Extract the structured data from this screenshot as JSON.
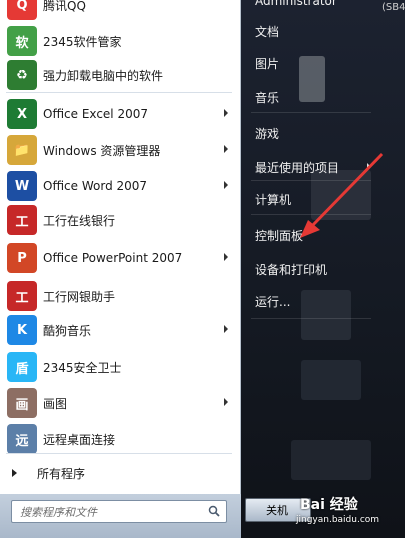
{
  "left_items": [
    {
      "label": "腾讯QQ",
      "icon": "qq-penguin-icon",
      "color": "#e53935",
      "glyph": "Q"
    },
    {
      "label": "2345软件管家",
      "icon": "software-manager-icon",
      "color": "#43a047",
      "glyph": "软"
    },
    {
      "label": "强力卸载电脑中的软件",
      "icon": "recycle-bin-icon",
      "color": "#2e7d32",
      "glyph": "♻"
    },
    {
      "label": "Office Excel 2007",
      "icon": "excel-icon",
      "color": "#1e7b34",
      "glyph": "X",
      "arrow": true
    },
    {
      "label": "Windows 资源管理器",
      "icon": "folder-explorer-icon",
      "color": "#d6a73a",
      "glyph": "📁",
      "arrow": true
    },
    {
      "label": "Office Word 2007",
      "icon": "word-icon",
      "color": "#1d4fa3",
      "glyph": "W",
      "arrow": true
    },
    {
      "label": "工行在线银行",
      "icon": "icbc-logo-icon",
      "color": "#c62828",
      "glyph": "工"
    },
    {
      "label": "Office PowerPoint 2007",
      "icon": "powerpoint-icon",
      "color": "#d24726",
      "glyph": "P",
      "arrow": true
    },
    {
      "label": "工行网银助手",
      "icon": "icbc-assistant-icon",
      "color": "#c62828",
      "glyph": "工"
    },
    {
      "label": "酷狗音乐",
      "icon": "kugou-music-icon",
      "color": "#1e88e5",
      "glyph": "K",
      "arrow": true
    },
    {
      "label": "2345安全卫士",
      "icon": "security-shield-icon",
      "color": "#29b6f6",
      "glyph": "盾"
    },
    {
      "label": "画图",
      "icon": "paint-palette-icon",
      "color": "#8d6e63",
      "glyph": "画",
      "arrow": true
    },
    {
      "label": "远程桌面连接",
      "icon": "remote-desktop-icon",
      "color": "#5c7fa8",
      "glyph": "远"
    }
  ],
  "all_programs": "所有程序",
  "search": {
    "placeholder": "搜索程序和文件"
  },
  "right_items": [
    {
      "label": "Administrator"
    },
    {
      "label": "文档"
    },
    {
      "label": "图片"
    },
    {
      "label": "音乐"
    },
    {
      "label": "游戏"
    },
    {
      "label": "最近使用的项目",
      "arrow": true
    },
    {
      "label": "计算机"
    },
    {
      "label": "控制面板"
    },
    {
      "label": "设备和打印机"
    },
    {
      "label": "运行..."
    }
  ],
  "shutdown_label": "关机",
  "corner_text": "(SB4",
  "watermark": {
    "brand": "Bai 经验",
    "url": "jingyan.baidu.com"
  }
}
